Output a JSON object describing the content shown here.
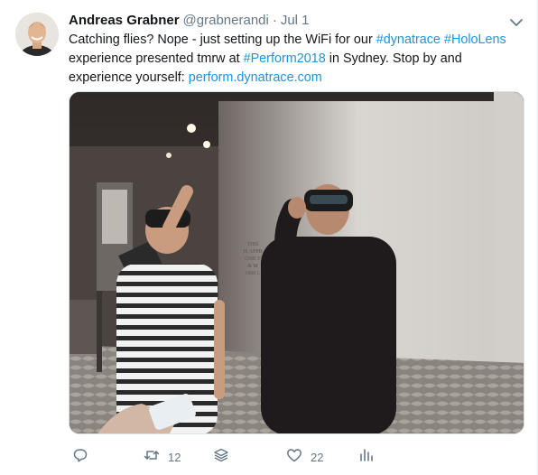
{
  "tweet": {
    "author_name": "Andreas Grabner",
    "handle": "@grabnerandi",
    "separator": "·",
    "time": "Jul 1",
    "text": {
      "t1": "Catching flies? Nope - just setting up the WiFi for our ",
      "h1": "#dynatrace",
      "t2": " ",
      "h2": "#HoloLens",
      "t3": " experience presented tmrw at ",
      "h3": "#Perform2018",
      "t4": " in Sydney. Stop by and experience yourself: ",
      "link": "perform.dynatrace.com"
    },
    "photo_sign": [
      "THIS",
      "IS APPR",
      "ONE T",
      "& M",
      "1060 L"
    ]
  },
  "actions": {
    "reply_count": "",
    "retweet_count": "12",
    "like_count": "22"
  },
  "colors": {
    "link": "#1b95e0",
    "meta": "#657786",
    "text": "#14171a"
  },
  "icons": {
    "caret": "chevron-down-icon",
    "reply": "reply-icon",
    "retweet": "retweet-icon",
    "stack": "stack-icon",
    "like": "heart-icon",
    "analytics": "analytics-icon"
  }
}
